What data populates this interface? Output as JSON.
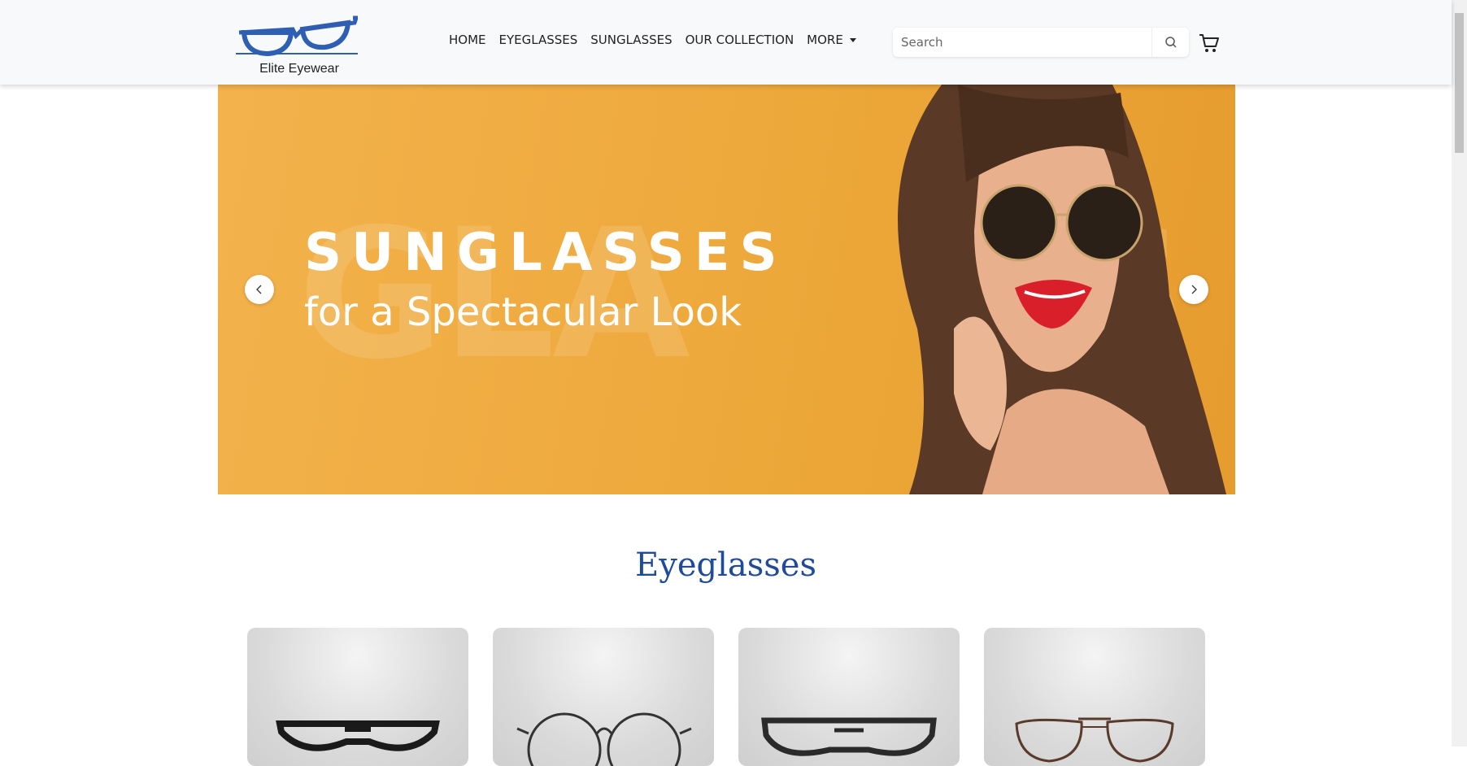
{
  "brand": {
    "name": "Elite Eyewear"
  },
  "nav": {
    "items": [
      "HOME",
      "EYEGLASSES",
      "SUNGLASSES",
      "OUR COLLECTION"
    ],
    "more_label": "MORE"
  },
  "search": {
    "placeholder": "Search"
  },
  "hero": {
    "title": "SUNGLASSES",
    "subtitle": "for a Spectacular Look",
    "bg_text": "GLASSES"
  },
  "section": {
    "title": "Eyeglasses"
  },
  "colors": {
    "brand_blue": "#1f4b99",
    "hero_orange": "#eda83a"
  }
}
